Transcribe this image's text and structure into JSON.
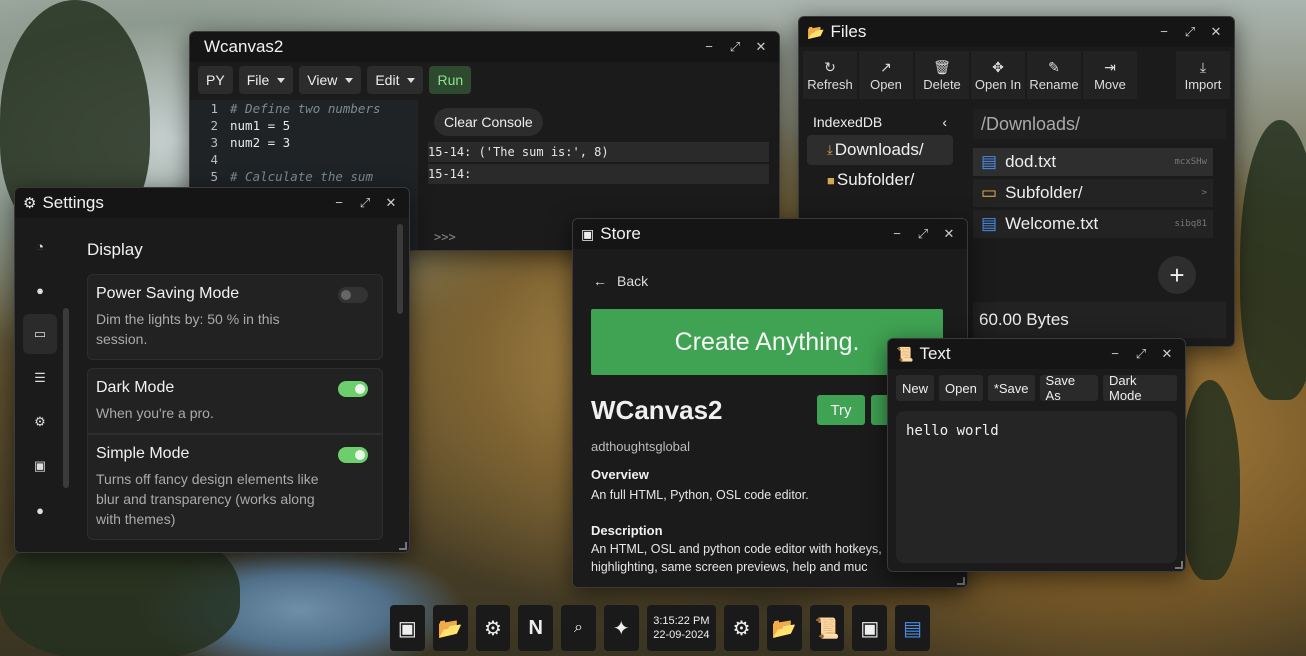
{
  "colors": {
    "accent_green": "#3fa353",
    "window_bg": "#1b1b1b",
    "toggle_on": "#6ccf6c"
  },
  "canvas": {
    "title": "Wcanvas2",
    "toolbar": {
      "py": "PY",
      "file": "File",
      "view": "View",
      "edit": "Edit",
      "run": "Run"
    },
    "code": [
      {
        "n": "1",
        "text": "# Define two numbers"
      },
      {
        "n": "2",
        "text": "num1 = 5"
      },
      {
        "n": "3",
        "text": "num2 = 3"
      },
      {
        "n": "4",
        "text": ""
      },
      {
        "n": "5",
        "text": "# Calculate the sum"
      }
    ],
    "console": {
      "clear": "Clear Console",
      "lines": [
        "15-14: ('The sum is:', 8)",
        "15-14:"
      ],
      "prompt": ">>>"
    }
  },
  "files": {
    "title": "Files",
    "toolbar": {
      "refresh": "Refresh",
      "open": "Open",
      "delete": "Delete",
      "open_in": "Open In",
      "rename": "Rename",
      "move": "Move",
      "import": "Import"
    },
    "sidebar": {
      "root": "IndexedDB",
      "items": [
        "Downloads/",
        "Subfolder/"
      ]
    },
    "path": "/Downloads/",
    "list": [
      {
        "name": "dod.txt",
        "meta": "mcxSHw",
        "type": "file"
      },
      {
        "name": "Subfolder/",
        "meta": ">",
        "type": "folder"
      },
      {
        "name": "Welcome.txt",
        "meta": "sibq81",
        "type": "file"
      }
    ],
    "size": "60.00 Bytes",
    "add": "+"
  },
  "settings": {
    "title": "Settings",
    "heading": "Display",
    "cards": [
      {
        "title": "Power Saving Mode",
        "desc": "Dim the lights by:  50     % in this session.",
        "on": false
      },
      {
        "title": "Dark Mode",
        "desc": "When you're a pro.",
        "on": true
      },
      {
        "title": "Simple Mode",
        "desc": "Turns off fancy design elements like blur and transparency (works along with themes)",
        "on": true
      }
    ]
  },
  "store": {
    "title": "Store",
    "back": "Back",
    "hero": "Create Anything.",
    "app": "WCanvas2",
    "try": "Try",
    "author": "adthoughtsglobal",
    "overview_h": "Overview",
    "overview": "An full HTML, Python, OSL code editor.",
    "desc_h": "Description",
    "desc": "An HTML, OSL and python code editor with hotkeys, highlighting, same screen previews, help and muc"
  },
  "text": {
    "title": "Text",
    "toolbar": {
      "new": "New",
      "open": "Open",
      "save": "*Save",
      "save_as": "Save As",
      "dark": "Dark Mode"
    },
    "content": "hello world"
  },
  "taskbar": {
    "time": "3:15:22 PM",
    "date": "22-09-2024"
  },
  "window_controls": {
    "min": "−",
    "max": "⤢",
    "close": "✕"
  }
}
